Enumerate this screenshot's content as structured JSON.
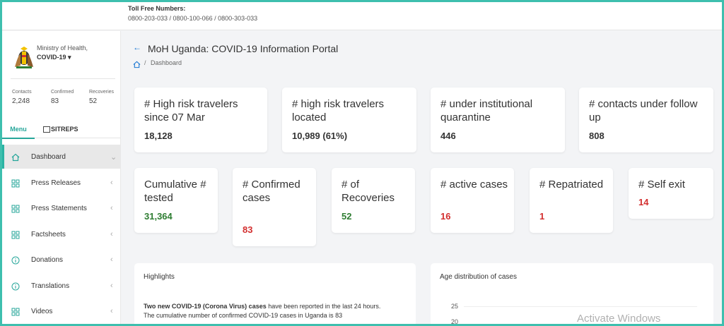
{
  "topbar": {
    "toll_title": "Toll Free Numbers:",
    "toll_numbers": "0800-203-033 / 0800-100-066 / 0800-303-033"
  },
  "sidebar": {
    "ministry": "Ministry of Health,",
    "covid_menu": "COVID-19 ▾",
    "stats": [
      {
        "label": "Contacts",
        "value": "2,248"
      },
      {
        "label": "Confirmed",
        "value": "83"
      },
      {
        "label": "Recoveries",
        "value": "52"
      }
    ],
    "tabs": {
      "menu": "Menu",
      "sitreps": "SITREPS"
    },
    "nav": [
      {
        "label": "Dashboard",
        "icon": "home-icon"
      },
      {
        "label": "Press Releases",
        "icon": "grid-icon"
      },
      {
        "label": "Press Statements",
        "icon": "grid-icon"
      },
      {
        "label": "Factsheets",
        "icon": "grid-icon"
      },
      {
        "label": "Donations",
        "icon": "info-icon"
      },
      {
        "label": "Translations",
        "icon": "info-icon"
      },
      {
        "label": "Videos",
        "icon": "grid-icon"
      }
    ]
  },
  "header": {
    "back": "←",
    "title": "MoH Uganda: COVID-19 Information Portal",
    "breadcrumb": "Dashboard",
    "sep": "/"
  },
  "cards_row1": [
    {
      "title": "# High risk travelers since 07 Mar",
      "value": "18,128"
    },
    {
      "title": "# high risk travelers located",
      "value": "10,989 (61%)"
    },
    {
      "title": "# under institutional quarantine",
      "value": "446"
    },
    {
      "title": "# contacts under follow up",
      "value": "808"
    }
  ],
  "cards_row2": [
    {
      "title": "Cumulative # tested",
      "value": "31,364",
      "color": "#2e7d32"
    },
    {
      "title": "# Confirmed cases",
      "value": "83",
      "color": "#d32f2f"
    },
    {
      "title": "# of Recoveries",
      "value": "52",
      "color": "#2e7d32"
    },
    {
      "title": "# active cases",
      "value": "16",
      "color": "#d32f2f"
    },
    {
      "title": "# Repatriated",
      "value": "1",
      "color": "#d32f2f"
    },
    {
      "title": "# Self exit",
      "value": "14",
      "color": "#d32f2f"
    }
  ],
  "highlights": {
    "title": "Highlights",
    "bold": "Two new COVID-19 (Corona Virus) cases",
    "text1": " have been reported in the last 24 hours.",
    "text2": "The cumulative number of confirmed COVID-19 cases in Uganda is 83"
  },
  "age_chart": {
    "title": "Age distribution of cases",
    "ticks": [
      "25",
      "20"
    ]
  },
  "watermark": "Activate Windows",
  "colors": {
    "accent": "#26a69a",
    "border": "#3ebfae",
    "link": "#1976d2"
  }
}
